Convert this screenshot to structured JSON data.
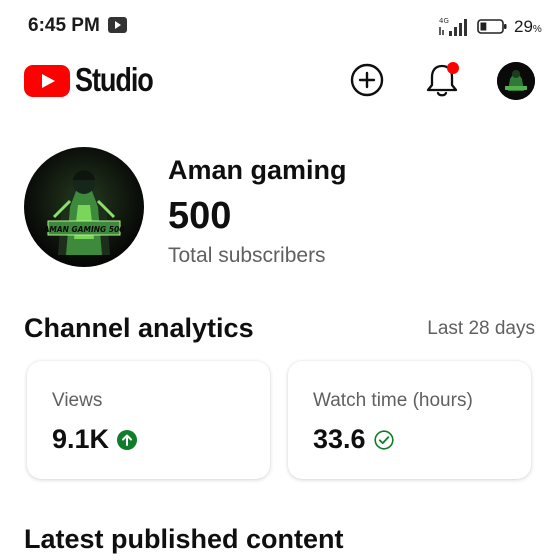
{
  "status_bar": {
    "time": "6:45 PM",
    "network_label": "4G",
    "battery_percent": "29",
    "battery_unit": "%",
    "battery_level": 0.29
  },
  "app_bar": {
    "brand": "Studio",
    "icons": [
      "youtube-logo-icon",
      "create-plus-icon",
      "bell-icon",
      "account-avatar"
    ],
    "notification_dot_color": "#ff0000"
  },
  "channel": {
    "name": "Aman gaming",
    "subscriber_count": "500",
    "subscriber_label": "Total subscribers",
    "avatar_text": "AMAN GAMING 500"
  },
  "analytics": {
    "title": "Channel analytics",
    "period": "Last 28 days",
    "cards": [
      {
        "label": "Views",
        "value": "9.1K",
        "status_icon": "arrow-up-circle-icon",
        "status_color": "#0f7d29"
      },
      {
        "label": "Watch time (hours)",
        "value": "33.6",
        "status_icon": "check-circle-icon",
        "status_color": "#0f7d29"
      }
    ]
  },
  "latest": {
    "title": "Latest published content"
  }
}
